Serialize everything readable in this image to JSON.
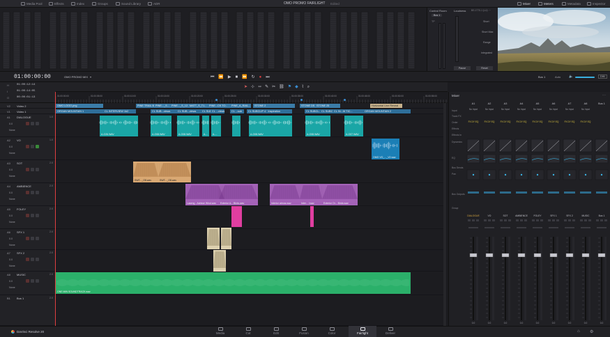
{
  "topbar": {
    "items": [
      "Media Pool",
      "Effects",
      "Index",
      "Groups",
      "Sound Library",
      "ADR"
    ],
    "project_title": "OMO PROMO FAIRLIGHT",
    "project_status": "Edited",
    "right_items": [
      "Mixer",
      "Meters",
      "Metadata",
      "Inspector"
    ]
  },
  "meters": {
    "control_room_label": "Control Room",
    "loudness_label": "Loudness",
    "loudness_standard": "BS.1770-1 (LU) ···",
    "bus_label": "Bus 1",
    "tp_label": "TP",
    "loudness_rows": [
      "Short",
      "Short Max",
      "Range",
      "Integrated"
    ],
    "pause_button": "Pause",
    "reset_button": "Reset"
  },
  "transport": {
    "timecode": "01:00:00:00",
    "timeline_name": "OMO PROMO MIX",
    "bus_select": "Bus 1",
    "auto_label": "Auto",
    "dim_label": "DIM"
  },
  "timecodes": [
    {
      "id": "H",
      "tc": "01:00:12:14"
    },
    {
      "id": "I",
      "tc": "01:00:14:05"
    },
    {
      "id": "O",
      "tc": "00:00:01:13"
    }
  ],
  "ruler_ticks": [
    "01:00:00:00",
    "01:00:05:00",
    "01:00:10:00",
    "01:00:15:00",
    "01:00:20:00",
    "01:00:25:00",
    "01:00:30:00",
    "01:00:35:00",
    "01:00:40:00",
    "01:00:45:00",
    "01:00:50:00",
    "01:00:55:00"
  ],
  "video_tracks": [
    {
      "id": "V2",
      "name": "Video 2"
    },
    {
      "id": "V1",
      "name": "Video 1"
    }
  ],
  "audio_tracks": [
    {
      "id": "A1",
      "name": "DIALOGUE",
      "ch": "1.0",
      "vol": "0.0",
      "pan": "None"
    },
    {
      "id": "A2",
      "name": "VO",
      "ch": "1.0",
      "vol": "0.0",
      "pan": "None"
    },
    {
      "id": "A3",
      "name": "SOT",
      "ch": "2.0",
      "vol": "0.0",
      "pan": "None"
    },
    {
      "id": "A4",
      "name": "AMBIENCE",
      "ch": "2.0",
      "vol": "0.0",
      "pan": "None"
    },
    {
      "id": "A5",
      "name": "FOLEY",
      "ch": "2.0",
      "vol": "0.0",
      "pan": "None"
    },
    {
      "id": "A6",
      "name": "SFX 1",
      "ch": "2.0",
      "vol": "0.0",
      "pan": "None"
    },
    {
      "id": "A7",
      "name": "SFX 2",
      "ch": "2.0",
      "vol": "0.0",
      "pan": "None"
    },
    {
      "id": "A8",
      "name": "MUSIC",
      "ch": "2.0",
      "vol": "0.0",
      "pan": "None"
    },
    {
      "id": "B1",
      "name": "Bus 1",
      "ch": "2.0",
      "vol": "",
      "pan": ""
    }
  ],
  "v2_clips": [
    "OMO LOGO.png",
    "PINE TRAIL B...",
    "PINE..._S...",
    "PINE..._S_12.",
    "MATT_S_T1...",
    "PINE...CK TO..",
    "PINE_A_RAIL...",
    "STONE 2",
    "STONE DS",
    "STONE 25"
  ],
  "v1_clips": [
    "ORGAN MOUNTAIN 1",
    "CL INTERVIEW 1b2",
    "CL SUB...views",
    "CL SUB...views",
    "CL SUB...views",
    "CL ...views",
    "CL ...sub",
    "CL SUBCLIP 4 · Inspiration",
    "CL SUBCL...",
    "CL SUBCL...",
    "CL IN...W TIC...",
    "Horizontal Line Reveal",
    "ORGAN MOUNTAIN 2"
  ],
  "audio_clip_labels": {
    "dialogue": [
      "A-O26.WAV",
      "A-O08.WAV",
      "A-O08.WAV",
      "A-O08.WAV",
      "A-...",
      "A-...",
      "A-O08.WAV",
      "A-O08.WAV",
      "A-O07.WAV"
    ],
    "vo": "OMO VO_..._V2.wav",
    "sot": [
      "SWT..._O8.wav",
      "SWT..._O8.wav"
    ],
    "ambience": [
      "Laseng - Ashtwe Wind.wav",
      "Exterior A... Birds.wav",
      "Interior atmos.wav",
      "Inter... l.wav",
      "Exterior Or... Birds.wav"
    ],
    "music": "ONE MIN SOUNDTRACK.wav"
  },
  "mixer": {
    "title": "Mixer",
    "strips": [
      "A1",
      "A2",
      "A3",
      "A4",
      "A5",
      "A6",
      "A7",
      "A8",
      "Bus 1"
    ],
    "row_labels": [
      "Input",
      "Track FX",
      "Order",
      "Effects",
      "Effects In",
      "Dynamics",
      "EQ",
      "Bus Sends",
      "Pan",
      "Bus Outputs",
      "Group"
    ],
    "input_value": "No Input",
    "order_value": "FX DY EQ",
    "channel_names": [
      "DIALOGUE",
      "VO",
      "SOT",
      "AMBIENCE",
      "FOLEY",
      "SFX 1",
      "SFX 2",
      "MUSIC",
      "Bus 1"
    ],
    "fader_value": "0.0"
  },
  "bottombar": {
    "app_name": "DaVinci Resolve 20",
    "pages": [
      "Media",
      "Cut",
      "Edit",
      "Fusion",
      "Color",
      "Fairlight",
      "Deliver"
    ],
    "active_page": "Fairlight"
  }
}
